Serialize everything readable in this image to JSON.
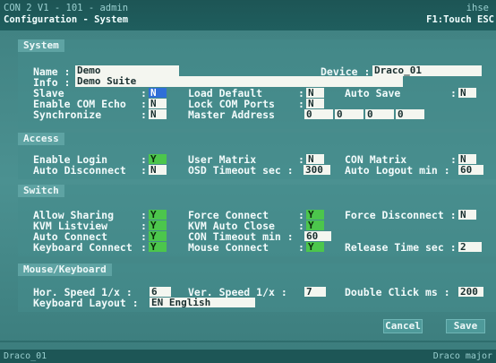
{
  "window": {
    "title": "CON 2 V1 - 101 - admin",
    "right_title": "ihse",
    "subtitle": "Configuration - System",
    "shortcut": "F1:Touch  ESC"
  },
  "sections": {
    "system": "System",
    "access": "Access",
    "switch": "Switch",
    "mouse_keyboard": "Mouse/Keyboard"
  },
  "system": {
    "name_label": "Name :",
    "name_value": "Demo",
    "info_label": "Info :",
    "info_value": "Demo Suite",
    "device_label": "Device :",
    "device_value": "Draco_01",
    "slave_label": "Slave",
    "slave_value": "N",
    "load_default_label": "Load Default",
    "load_default_value": "N",
    "auto_save_label": "Auto Save",
    "auto_save_value": "N",
    "enable_com_echo_label": "Enable COM Echo",
    "enable_com_echo_value": "N",
    "lock_com_ports_label": "Lock COM Ports",
    "lock_com_ports_value": "N",
    "synchronize_label": "Synchronize",
    "synchronize_value": "N",
    "master_address_label": "Master Address",
    "master_address": [
      "0",
      "0",
      "0",
      "0"
    ]
  },
  "access": {
    "enable_login_label": "Enable Login",
    "enable_login_value": "Y",
    "user_matrix_label": "User Matrix",
    "user_matrix_value": "N",
    "con_matrix_label": "CON Matrix",
    "con_matrix_value": "N",
    "auto_disconnect_label": "Auto Disconnect",
    "auto_disconnect_value": "N",
    "osd_timeout_label": "OSD Timeout  sec :",
    "osd_timeout_value": "300",
    "auto_logout_label": "Auto Logout  min :",
    "auto_logout_value": "60"
  },
  "switch": {
    "allow_sharing_label": "Allow Sharing",
    "allow_sharing_value": "Y",
    "force_connect_label": "Force Connect",
    "force_connect_value": "Y",
    "force_disconnect_label": "Force Disconnect :",
    "force_disconnect_value": "N",
    "kvm_listview_label": "KVM Listview",
    "kvm_listview_value": "Y",
    "kvm_auto_close_label": "KVM Auto Close",
    "kvm_auto_close_value": "Y",
    "auto_connect_label": "Auto Connect",
    "auto_connect_value": "Y",
    "con_timeout_label": "CON Timeout  min :",
    "con_timeout_value": "60",
    "keyboard_connect_label": "Keyboard Connect",
    "keyboard_connect_value": "Y",
    "mouse_connect_label": "Mouse Connect",
    "mouse_connect_value": "Y",
    "release_time_label": "Release Time sec :",
    "release_time_value": "2"
  },
  "mouse_keyboard": {
    "hor_speed_label": "Hor. Speed   1/x :",
    "hor_speed_value": "6",
    "ver_speed_label": "Ver. Speed   1/x :",
    "ver_speed_value": "7",
    "double_click_label": "Double Click  ms :",
    "double_click_value": "200",
    "keyboard_layout_label": "Keyboard Layout  :",
    "keyboard_layout_value": "EN English"
  },
  "buttons": {
    "cancel": "Cancel",
    "save": "Save"
  },
  "footer": {
    "left": "Draco_01",
    "right": "Draco major"
  },
  "colors": {
    "background": "#3f8585",
    "yes_box": "#4cc64c",
    "selected": "#2f6fd8",
    "field": "#f4f6f0"
  }
}
